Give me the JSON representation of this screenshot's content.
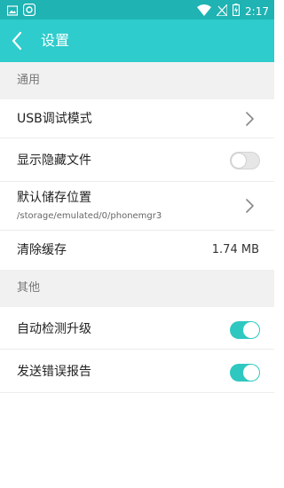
{
  "status_bar": {
    "time": "2:17",
    "icons": [
      "image-icon",
      "camera-app-icon",
      "wifi-icon",
      "no-signal-icon",
      "battery-charging-icon"
    ]
  },
  "toolbar": {
    "back_icon": "chevron-left-icon",
    "title": "设置"
  },
  "sections": [
    {
      "header": "通用",
      "items": [
        {
          "label": "USB调试模式",
          "control": "chevron"
        },
        {
          "label": "显示隐藏文件",
          "control": "toggle",
          "checked": false
        },
        {
          "label": "默认储存位置",
          "sublabel": "/storage/emulated/0/phonemgr3",
          "control": "chevron"
        },
        {
          "label": "清除缓存",
          "value": "1.74 MB",
          "control": "value"
        }
      ]
    },
    {
      "header": "其他",
      "items": [
        {
          "label": "自动检测升级",
          "control": "toggle",
          "checked": true
        },
        {
          "label": "发送错误报告",
          "control": "toggle",
          "checked": true
        }
      ]
    }
  ],
  "colors": {
    "status_bar": "#1fb3b3",
    "toolbar": "#2ecccc",
    "toggle_on": "#2ec8c0",
    "section_bg": "#f1f1f1"
  }
}
